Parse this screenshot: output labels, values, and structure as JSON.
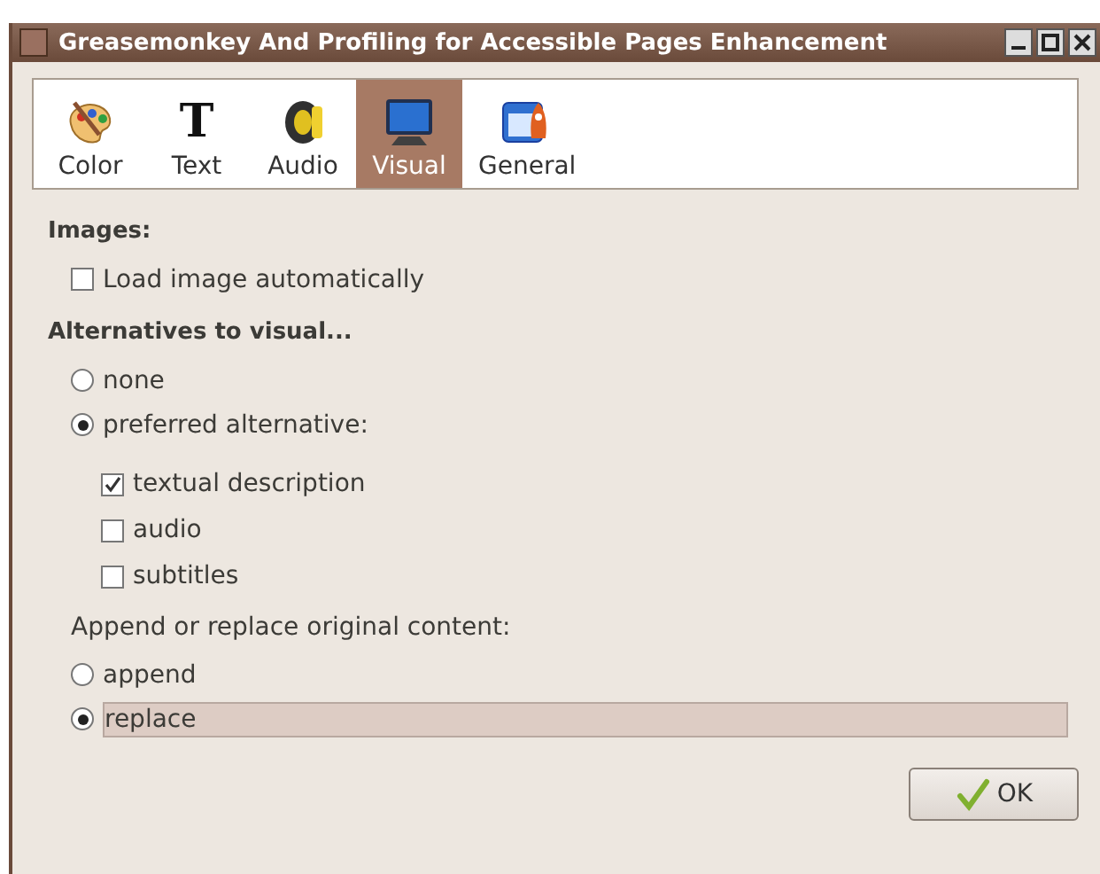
{
  "window": {
    "title": "Greasemonkey And Profiling for Accessible Pages Enhancement"
  },
  "tabs": [
    {
      "label": "Color",
      "kind": "palette",
      "selected": false
    },
    {
      "label": "Text",
      "kind": "glyph",
      "glyph": "T",
      "selected": false
    },
    {
      "label": "Audio",
      "kind": "speaker",
      "selected": false
    },
    {
      "label": "Visual",
      "kind": "monitor",
      "selected": true
    },
    {
      "label": "General",
      "kind": "window",
      "selected": false
    }
  ],
  "images": {
    "heading": "Images:",
    "load_automatically": {
      "label": "Load image automatically",
      "checked": false
    }
  },
  "alternatives": {
    "heading": "Alternatives to visual...",
    "options": [
      {
        "label": "none",
        "selected": false
      },
      {
        "label": "preferred alternative:",
        "selected": true
      }
    ],
    "preferred": [
      {
        "label": "textual description",
        "checked": true
      },
      {
        "label": "audio",
        "checked": false
      },
      {
        "label": "subtitles",
        "checked": false
      }
    ],
    "mode_label": "Append or replace original content:",
    "modes": [
      {
        "label": "append",
        "selected": false
      },
      {
        "label": "replace",
        "selected": true
      }
    ]
  },
  "buttons": [
    {
      "label": "OK"
    }
  ]
}
